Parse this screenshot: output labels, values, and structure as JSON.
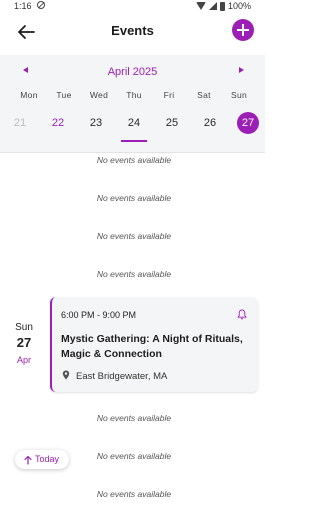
{
  "status_bar": {
    "time": "1:16",
    "battery": "100%"
  },
  "app_bar": {
    "title": "Events"
  },
  "calendar": {
    "month": "April 2025",
    "weekdays": [
      "Mon",
      "Tue",
      "Wed",
      "Thu",
      "Fri",
      "Sat",
      "Sun"
    ],
    "days": [
      "21",
      "22",
      "23",
      "24",
      "25",
      "26",
      "27"
    ],
    "selected_day": "24",
    "today_day": "27"
  },
  "event_list": {
    "no_events_text": "No events available"
  },
  "event": {
    "dow": "Sun",
    "day": "27",
    "month": "Apr",
    "time": "6:00 PM - 9:00 PM",
    "title": "Mystic Gathering: A Night of Rituals, Magic & Connection",
    "location": "East Bridgewater, MA"
  },
  "today_button": {
    "label": "Today"
  },
  "colors": {
    "accent": "#9c1fb5",
    "calendar_bg": "#f4f5f7"
  }
}
